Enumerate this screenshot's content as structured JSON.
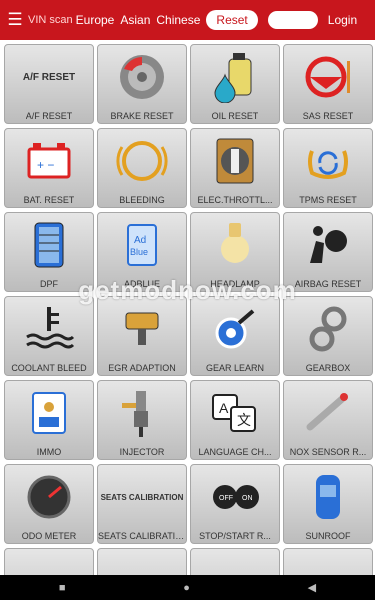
{
  "topbar": {
    "vin_scan": "VIN scan",
    "tabs": [
      "Europe",
      "Asian",
      "Chinese"
    ],
    "active": "Reset",
    "login": "Login"
  },
  "tiles": [
    {
      "label": "A/F RESET",
      "icon": "af-reset-text"
    },
    {
      "label": "BRAKE RESET",
      "icon": "brake-disc-icon"
    },
    {
      "label": "OIL RESET",
      "icon": "oil-bottle-icon"
    },
    {
      "label": "SAS RESET",
      "icon": "steering-wheel-icon"
    },
    {
      "label": "BAT. RESET",
      "icon": "battery-icon"
    },
    {
      "label": "BLEEDING",
      "icon": "brake-warning-icon"
    },
    {
      "label": "ELEC.THROTTL...",
      "icon": "throttle-icon"
    },
    {
      "label": "TPMS RESET",
      "icon": "tire-pressure-icon"
    },
    {
      "label": "DPF",
      "icon": "dpf-filter-icon"
    },
    {
      "label": "ADBLUE",
      "icon": "adblue-icon"
    },
    {
      "label": "HEADLAMP",
      "icon": "headlamp-icon"
    },
    {
      "label": "AIRBAG RESET",
      "icon": "airbag-icon"
    },
    {
      "label": "COOLANT BLEED",
      "icon": "coolant-icon"
    },
    {
      "label": "EGR ADAPTION",
      "icon": "egr-valve-icon"
    },
    {
      "label": "GEAR LEARN",
      "icon": "gear-learn-icon"
    },
    {
      "label": "GEARBOX",
      "icon": "gearbox-icon"
    },
    {
      "label": "IMMO",
      "icon": "immo-key-icon"
    },
    {
      "label": "INJECTOR",
      "icon": "injector-icon"
    },
    {
      "label": "LANGUAGE CH...",
      "icon": "language-icon"
    },
    {
      "label": "NOX SENSOR R...",
      "icon": "nox-sensor-icon"
    },
    {
      "label": "ODO METER",
      "icon": "odometer-icon"
    },
    {
      "label": "SEATS CALIBRATION",
      "icon": "seats-calibration-text"
    },
    {
      "label": "STOP/START R...",
      "icon": "stop-start-icon"
    },
    {
      "label": "SUNROOF",
      "icon": "sunroof-icon"
    },
    {
      "label": "",
      "icon": "partial-icon"
    },
    {
      "label": "",
      "icon": "partial-icon"
    },
    {
      "label": "",
      "icon": "partial-icon"
    },
    {
      "label": "",
      "icon": "partial-icon"
    }
  ],
  "watermark": "getmodnow.com",
  "navbar": {
    "back": "◀",
    "home": "●",
    "recent": "■"
  }
}
